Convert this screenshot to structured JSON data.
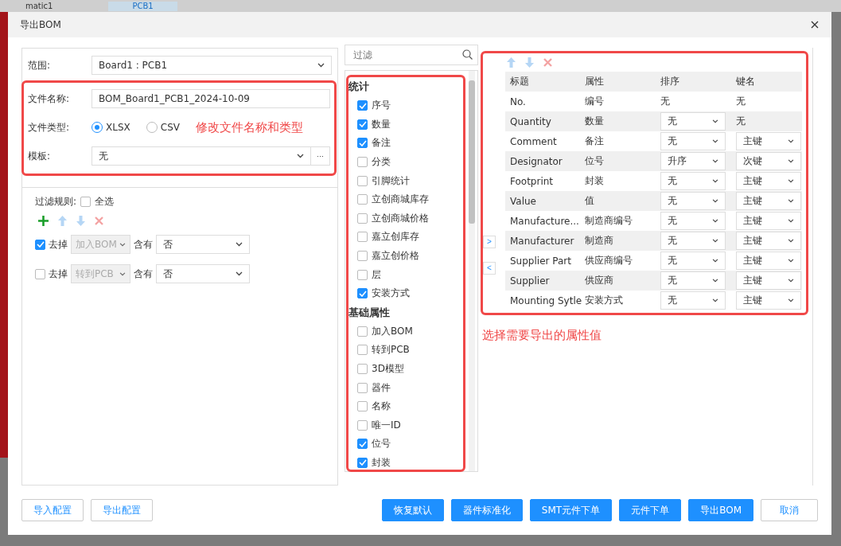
{
  "background": {
    "tabs": [
      {
        "label": "matic1",
        "selected": false
      },
      {
        "label": "PCB1",
        "selected": true
      }
    ]
  },
  "dialog": {
    "title": "导出BOM"
  },
  "scope": {
    "label": "范围:",
    "value": "Board1 : PCB1"
  },
  "file_name": {
    "label": "文件名称:",
    "value": "BOM_Board1_PCB1_2024-10-09"
  },
  "file_type": {
    "label": "文件类型:",
    "options": [
      {
        "label": "XLSX",
        "selected": true
      },
      {
        "label": "CSV",
        "selected": false
      }
    ],
    "annotation": "修改文件名称和类型"
  },
  "template": {
    "label": "模板:",
    "value": "无",
    "more": "···"
  },
  "filter_rules": {
    "label": "过滤规则:",
    "select_all": {
      "label": "全选",
      "checked": false
    },
    "rules": [
      {
        "checked": true,
        "action": "去掉",
        "field": "加入BOM",
        "op": "含有",
        "value": "否"
      },
      {
        "checked": false,
        "action": "去掉",
        "field": "转到PCB",
        "op": "含有",
        "value": "否"
      }
    ]
  },
  "property_search": {
    "placeholder": "过滤"
  },
  "property_groups": [
    {
      "title": "统计",
      "items": [
        {
          "label": "序号",
          "checked": true
        },
        {
          "label": "数量",
          "checked": true
        },
        {
          "label": "备注",
          "checked": true
        },
        {
          "label": "分类",
          "checked": false
        },
        {
          "label": "引脚统计",
          "checked": false
        },
        {
          "label": "立创商城库存",
          "checked": false
        },
        {
          "label": "立创商城价格",
          "checked": false
        },
        {
          "label": "嘉立创库存",
          "checked": false
        },
        {
          "label": "嘉立创价格",
          "checked": false
        },
        {
          "label": "层",
          "checked": false
        },
        {
          "label": "安装方式",
          "checked": true
        }
      ]
    },
    {
      "title": "基础属性",
      "items": [
        {
          "label": "加入BOM",
          "checked": false
        },
        {
          "label": "转到PCB",
          "checked": false
        },
        {
          "label": "3D模型",
          "checked": false
        },
        {
          "label": "器件",
          "checked": false
        },
        {
          "label": "名称",
          "checked": false
        },
        {
          "label": "唯一ID",
          "checked": false
        },
        {
          "label": "位号",
          "checked": true
        },
        {
          "label": "封装",
          "checked": true
        }
      ]
    }
  ],
  "move_buttons": [
    ">",
    "<"
  ],
  "table": {
    "columns": [
      "标题",
      "属性",
      "排序",
      "键名"
    ],
    "rows": [
      {
        "title": "No.",
        "property": "编号",
        "sort": {
          "kind": "text",
          "value": "无"
        },
        "key": {
          "kind": "text",
          "value": "无"
        }
      },
      {
        "title": "Quantity",
        "property": "数量",
        "sort": {
          "kind": "select",
          "value": "无"
        },
        "key": {
          "kind": "text",
          "value": "无"
        }
      },
      {
        "title": "Comment",
        "property": "备注",
        "sort": {
          "kind": "select",
          "value": "无"
        },
        "key": {
          "kind": "select",
          "value": "主键"
        }
      },
      {
        "title": "Designator",
        "property": "位号",
        "sort": {
          "kind": "select",
          "value": "升序"
        },
        "key": {
          "kind": "select",
          "value": "次键"
        }
      },
      {
        "title": "Footprint",
        "property": "封装",
        "sort": {
          "kind": "select",
          "value": "无"
        },
        "key": {
          "kind": "select",
          "value": "主键"
        }
      },
      {
        "title": "Value",
        "property": "值",
        "sort": {
          "kind": "select",
          "value": "无"
        },
        "key": {
          "kind": "select",
          "value": "主键"
        }
      },
      {
        "title": "Manufacture...",
        "property": "制造商编号",
        "sort": {
          "kind": "select",
          "value": "无"
        },
        "key": {
          "kind": "select",
          "value": "主键"
        }
      },
      {
        "title": "Manufacturer",
        "property": "制造商",
        "sort": {
          "kind": "select",
          "value": "无"
        },
        "key": {
          "kind": "select",
          "value": "主键"
        }
      },
      {
        "title": "Supplier Part",
        "property": "供应商编号",
        "sort": {
          "kind": "select",
          "value": "无"
        },
        "key": {
          "kind": "select",
          "value": "主键"
        }
      },
      {
        "title": "Supplier",
        "property": "供应商",
        "sort": {
          "kind": "select",
          "value": "无"
        },
        "key": {
          "kind": "select",
          "value": "主键"
        }
      },
      {
        "title": "Mounting Sytle",
        "property": "安装方式",
        "sort": {
          "kind": "select",
          "value": "无"
        },
        "key": {
          "kind": "select",
          "value": "主键"
        }
      }
    ]
  },
  "table_annotation": "选择需要导出的属性值",
  "footer_left": [
    "导入配置",
    "导出配置"
  ],
  "footer_right": [
    {
      "label": "恢复默认",
      "kind": "primary"
    },
    {
      "label": "器件标准化",
      "kind": "primary"
    },
    {
      "label": "SMT元件下单",
      "kind": "primary"
    },
    {
      "label": "元件下单",
      "kind": "primary"
    },
    {
      "label": "导出BOM",
      "kind": "primary"
    },
    {
      "label": "取消",
      "kind": "default"
    }
  ]
}
